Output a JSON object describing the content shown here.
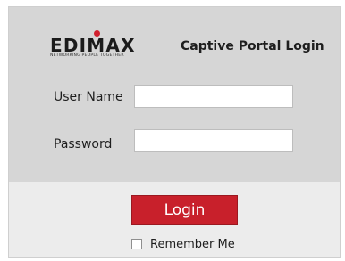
{
  "brand": {
    "name": "EDIMAX",
    "tagline": "NETWORKING PEOPLE TOGETHER",
    "accent_color": "#c8202b"
  },
  "header": {
    "title": "Captive Portal Login"
  },
  "form": {
    "username_label": "User Name",
    "username_value": "",
    "password_label": "Password",
    "password_value": "",
    "login_label": "Login",
    "remember_label": "Remember Me",
    "remember_checked": false
  }
}
